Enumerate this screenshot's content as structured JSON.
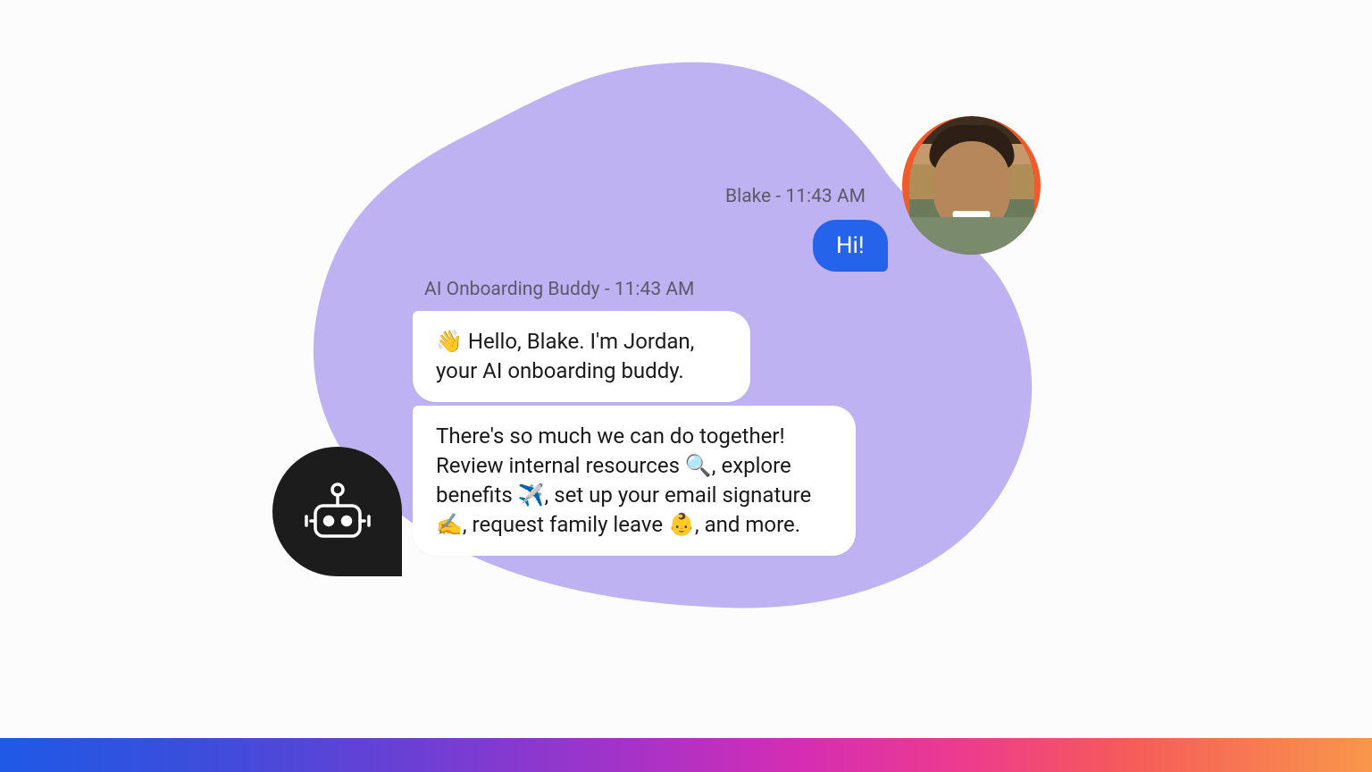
{
  "user": {
    "name": "Blake",
    "timestamp": "11:43 AM",
    "meta_label": "Blake - 11:43 AM",
    "message": "Hi!"
  },
  "ai": {
    "name": "AI Onboarding Buddy",
    "timestamp": "11:43 AM",
    "meta_label": "AI Onboarding Buddy - 11:43 AM",
    "message_1": "👋 Hello, Blake. I'm Jordan, your AI onboarding buddy.",
    "message_2": "There's so much we can do together! Review internal resources 🔍, explore benefits ✈️, set up your email signature ✍️, request family leave 👶, and more."
  },
  "colors": {
    "blob": "#bfb2f2",
    "user_bubble": "#2563eb",
    "avatar_bg": "#f15a29",
    "bot_bg": "#1c1c1c"
  }
}
